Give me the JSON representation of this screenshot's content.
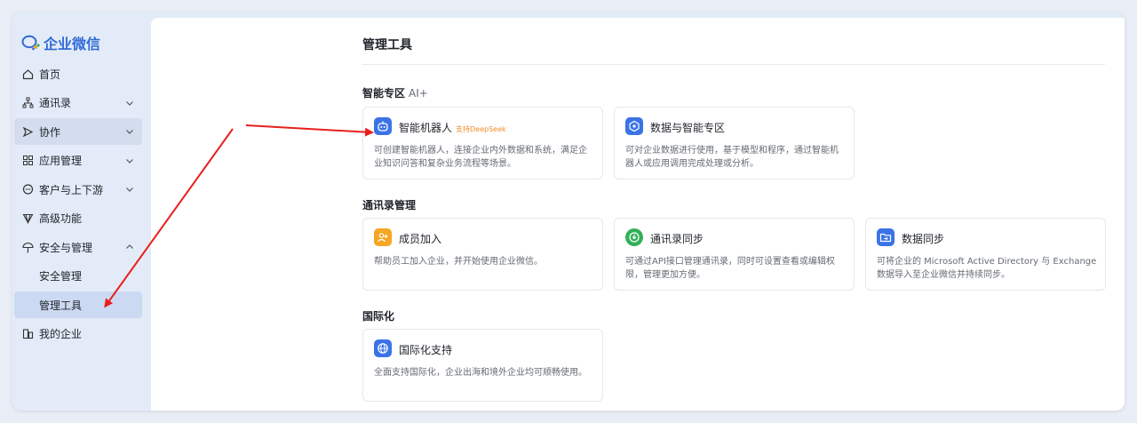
{
  "app": {
    "name": "企业微信"
  },
  "sidebar": {
    "items": [
      {
        "label": "首页"
      },
      {
        "label": "通讯录"
      },
      {
        "label": "协作"
      },
      {
        "label": "应用管理"
      },
      {
        "label": "客户与上下游"
      },
      {
        "label": "高级功能"
      },
      {
        "label": "安全与管理"
      },
      {
        "label": "安全管理"
      },
      {
        "label": "管理工具"
      },
      {
        "label": "我的企业"
      }
    ]
  },
  "main": {
    "title": "管理工具",
    "sections": [
      {
        "title": "智能专区",
        "ai_tag": "AI+",
        "cards": [
          {
            "title": "智能机器人",
            "badge": "支持DeepSeek",
            "desc": "可创建智能机器人，连接企业内外数据和系统，满足企业知识问答和复杂业务流程等场景。",
            "icon": "robot-icon"
          },
          {
            "title": "数据与智能专区",
            "desc": "可对企业数据进行使用，基于模型和程序，通过智能机器人或应用调用完成处理或分析。",
            "icon": "data-ai-icon"
          }
        ]
      },
      {
        "title": "通讯录管理",
        "cards": [
          {
            "title": "成员加入",
            "desc": "帮助员工加入企业，并开始使用企业微信。",
            "icon": "member-join-icon"
          },
          {
            "title": "通讯录同步",
            "desc": "可通过API接口管理通讯录，同时可设置查看或编辑权限，管理更加方便。",
            "icon": "contacts-sync-icon"
          },
          {
            "title": "数据同步",
            "desc": "可将企业的 Microsoft Active Directory 与 Exchange 数据导入至企业微信并持续同步。",
            "icon": "data-sync-icon"
          }
        ]
      },
      {
        "title": "国际化",
        "cards": [
          {
            "title": "国际化支持",
            "desc": "全面支持国际化，企业出海和境外企业均可顺畅使用。",
            "icon": "globe-icon"
          }
        ]
      }
    ]
  },
  "colors": {
    "brand": "#2f6bd6",
    "badge": "#f08b2d",
    "annotation_arrow": "#e8201c",
    "icon_blue": "#3b73e6",
    "icon_orange": "#f5a623",
    "icon_green": "#34b05a"
  }
}
